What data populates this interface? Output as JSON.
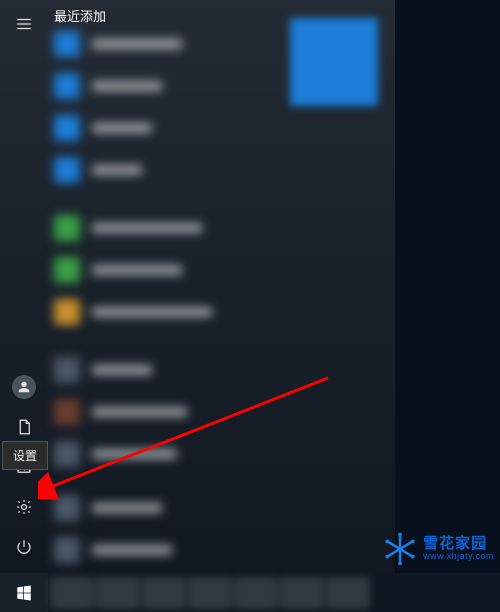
{
  "header": {
    "title": "最近添加"
  },
  "tooltip": {
    "settings": "设置"
  },
  "watermark": {
    "name": "雪花家园",
    "url": "www.xhjaty.com"
  },
  "railIcons": {
    "hamburger": "hamburger-icon",
    "user": "user-icon",
    "documents": "documents-icon",
    "pictures": "pictures-icon",
    "settings": "gear-icon",
    "power": "power-icon",
    "start": "windows-logo-icon"
  }
}
